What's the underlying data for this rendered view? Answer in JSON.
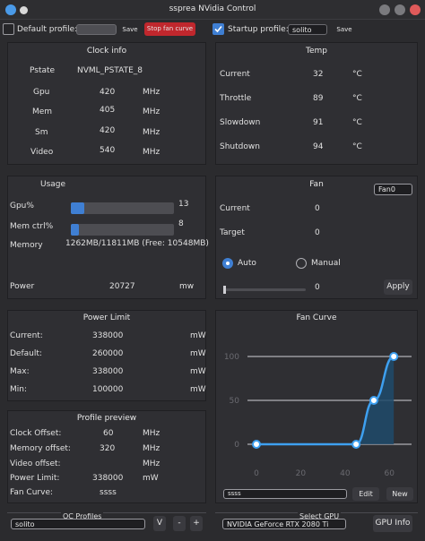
{
  "window": {
    "title": "ssprea NVidia Control"
  },
  "toolbar": {
    "default_profile_label": "Default profile:",
    "default_profile_checked": false,
    "default_profile_value": "",
    "save_label": "Save",
    "stop_fan_curve_label": "Stop fan curve",
    "startup_profile_label": "Startup profile:",
    "startup_profile_checked": true,
    "startup_profile_value": "solito",
    "save2_label": "Save"
  },
  "clock_info": {
    "title": "Clock info",
    "rows": [
      {
        "label": "Pstate",
        "value": "NVML_PSTATE_8",
        "unit": ""
      },
      {
        "label": "Gpu",
        "value": "420",
        "unit": "MHz"
      },
      {
        "label": "Mem",
        "value": "405",
        "unit": "MHz"
      },
      {
        "label": "Sm",
        "value": "420",
        "unit": "MHz"
      },
      {
        "label": "Video",
        "value": "540",
        "unit": "MHz"
      }
    ]
  },
  "temp": {
    "title": "Temp",
    "rows": [
      {
        "label": "Current",
        "value": "32",
        "unit": "°C"
      },
      {
        "label": "Throttle",
        "value": "89",
        "unit": "°C"
      },
      {
        "label": "Slowdown",
        "value": "91",
        "unit": "°C"
      },
      {
        "label": "Shutdown",
        "value": "94",
        "unit": "°C"
      }
    ]
  },
  "usage": {
    "title": "Usage",
    "gpu_label": "Gpu%",
    "gpu_value": "13",
    "gpu_fraction": 0.13,
    "memctrl_label": "Mem ctrl%",
    "memctrl_value": "8",
    "memctrl_fraction": 0.08,
    "memory_label": "Memory",
    "memory_value": "1262MB/11811MB (Free: 10548MB)",
    "power_label": "Power",
    "power_value": "20727",
    "power_unit": "mw"
  },
  "fan": {
    "title": "Fan",
    "fan_select": "Fan0",
    "current_label": "Current",
    "current_value": "0",
    "target_label": "Target",
    "target_value": "0",
    "auto_label": "Auto",
    "auto_selected": true,
    "manual_label": "Manual",
    "slider_value": "0",
    "apply_label": "Apply"
  },
  "power_limit": {
    "title": "Power Limit",
    "rows": [
      {
        "label": "Current:",
        "value": "338000",
        "unit": "mW"
      },
      {
        "label": "Default:",
        "value": "260000",
        "unit": "mW"
      },
      {
        "label": "Max:",
        "value": "338000",
        "unit": "mW"
      },
      {
        "label": "Min:",
        "value": "100000",
        "unit": "mW"
      }
    ]
  },
  "profile_preview": {
    "title": "Profile preview",
    "rows": [
      {
        "label": "Clock Offset:",
        "value": "60",
        "unit": "MHz"
      },
      {
        "label": "Memory offset:",
        "value": "320",
        "unit": "MHz"
      },
      {
        "label": "Video offset:",
        "value": "",
        "unit": "MHz"
      },
      {
        "label": "Power Limit:",
        "value": "338000",
        "unit": "mW"
      },
      {
        "label": "Fan Curve:",
        "value": "ssss",
        "unit": ""
      }
    ]
  },
  "fan_curve": {
    "title": "Fan Curve",
    "curve_select": "ssss",
    "edit_label": "Edit",
    "new_label": "New"
  },
  "chart_data": {
    "type": "area",
    "x": [
      0,
      45,
      53,
      62
    ],
    "values": [
      0,
      0,
      50,
      100
    ],
    "ylim": [
      0,
      100
    ],
    "xticks": [
      "0",
      "20",
      "40",
      "60"
    ],
    "xtick_values": [
      0,
      20,
      40,
      60
    ],
    "yticks": [
      "0",
      "50",
      "100"
    ],
    "ytick_values": [
      0,
      50,
      100
    ],
    "xlim": [
      0,
      68
    ],
    "grid": true,
    "color": "#3ea0f0"
  },
  "oc_profiles": {
    "title": "OC Profiles",
    "value": "solito",
    "v_label": "V",
    "minus_label": "-",
    "plus_label": "+"
  },
  "select_gpu": {
    "title": "Select GPU",
    "value": "NVIDIA GeForce RTX 2080 Ti",
    "gpu_info_label": "GPU Info"
  },
  "colors": {
    "accent": "#3f7fd3",
    "stop_button": "#c0272d",
    "background": "#2b2b2e",
    "panel": "#2f2f33"
  }
}
